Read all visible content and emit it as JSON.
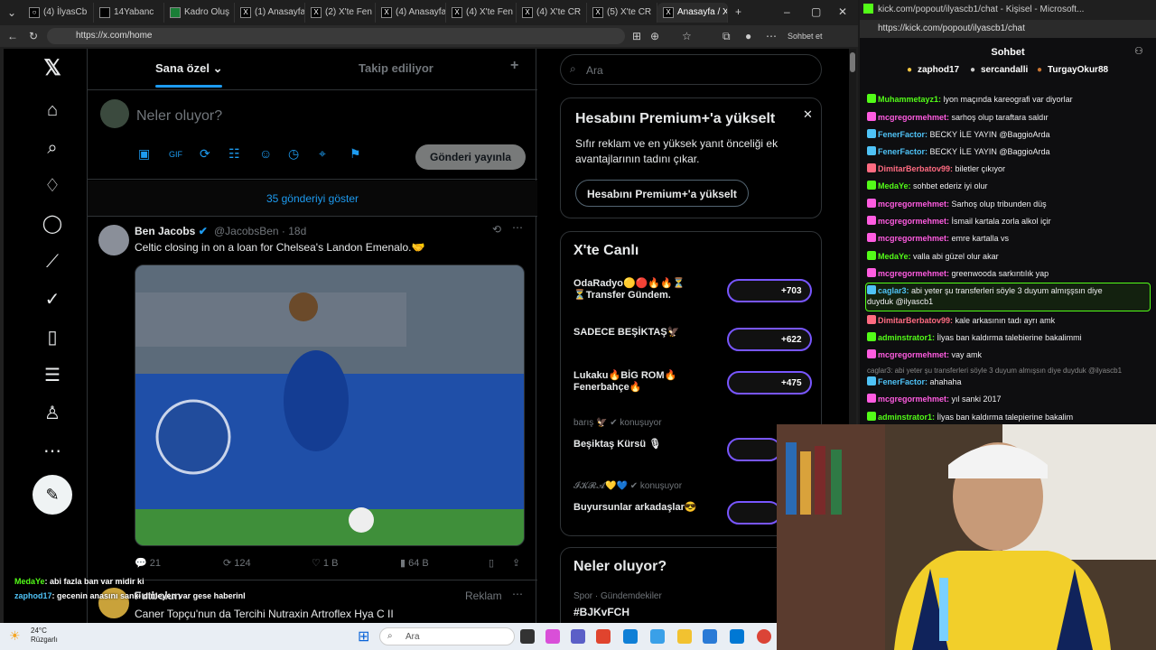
{
  "browser": {
    "tabs": [
      {
        "label": "(4) İlyasCb"
      },
      {
        "label": "14Yabanc"
      },
      {
        "label": "Kadro Oluş"
      },
      {
        "label": "(1) Anasayfa"
      },
      {
        "label": "(2) X'te Fen"
      },
      {
        "label": "(4) Anasayfa"
      },
      {
        "label": "(4) X'te Fen"
      },
      {
        "label": "(4) X'te CR"
      },
      {
        "label": "(5) X'te CR"
      },
      {
        "label": "Anasayfa / X"
      }
    ],
    "url": "https://x.com/home",
    "sidebar_btn": "Sohbet et"
  },
  "x": {
    "tabs": {
      "for_you": "Sana özel",
      "following": "Takip ediliyor"
    },
    "composer_placeholder": "Neler oluyor?",
    "post_button": "Gönderi yayınla",
    "show_more": "35 gönderiyi göster",
    "tweet": {
      "name": "Ben Jacobs",
      "handle": "@JacobsBen · 18d",
      "text": "Celtic closing in on a loan for Chelsea's Landon Emenalo.🤝",
      "replies": "21",
      "reposts": "124",
      "likes": "1 B",
      "views": "64 B"
    },
    "tweet2": {
      "name": "Futbolun",
      "text": "Caner Topçu'nun da Tercihi Nutraxin Artroflex Hya C II",
      "badge": "Reklam"
    },
    "search_placeholder": "Ara",
    "premium": {
      "title": "Hesabını Premium+'a yükselt",
      "body": "Sıfır reklam ve en yüksek yanıt önceliği ek avantajlarının tadını çıkar.",
      "button": "Hesabını Premium+'a yükselt"
    },
    "live": {
      "title": "X'te Canlı",
      "items": [
        {
          "title": "OdaRadyo🟡🔴🔥🔥⏳",
          "title2": "⏳Transfer Gündem.",
          "count": "+703"
        },
        {
          "title": "SADECE BEŞİKTAŞ🦅",
          "title2": "",
          "count": "+622"
        },
        {
          "title": "Lukaku🔥BİG ROM🔥",
          "title2": "Fenerbahçe🔥",
          "count": "+475"
        },
        {
          "sub": "barış 🦅 ✔ konuşuyor",
          "title": "Beşiktaş Kürsü 🎙",
          "count": ""
        },
        {
          "sub": "𝓘𝓚𝓡𝓐💛💙 ✔ konuşuyor",
          "title": "Buyursunlar arkadaşlar😎",
          "count": ""
        }
      ]
    },
    "trends": {
      "title": "Neler oluyor?",
      "sub": "Spor · Gündemdekiler",
      "tag": "#BJKvFCH"
    }
  },
  "chat": {
    "window_title": "kick.com/popout/ilyascb1/chat - Kişisel - Microsoft...",
    "url": "https://kick.com/popout/ilyascb1/chat",
    "header": "Sohbet",
    "top_gifters": [
      "zaphod17",
      "sercandalli",
      "TurgayOkur88"
    ],
    "messages": [
      {
        "user": "Muhammetayz1:",
        "text": "lyon maçında kareografi var diyorlar",
        "color": "#53fc18"
      },
      {
        "user": "mcgregormehmet:",
        "text": "sarhoş olup taraftara saldır",
        "color": "#ff5ce1"
      },
      {
        "user": "FenerFactor:",
        "text": "BECKY İLE YAYIN @BaggioArda",
        "color": "#4fc3f7"
      },
      {
        "user": "FenerFactor:",
        "text": "BECKY İLE YAYIN @BaggioArda",
        "color": "#4fc3f7"
      },
      {
        "user": "DimitarBerbatov99:",
        "text": "biletler çıkıyor",
        "color": "#ff6b81"
      },
      {
        "user": "MedaYe:",
        "text": "sohbet ederiz iyi olur",
        "color": "#53fc18"
      },
      {
        "user": "mcgregormehmet:",
        "text": "Sarhoş olup tribunden düş",
        "color": "#ff5ce1"
      },
      {
        "user": "mcgregormehmet:",
        "text": "İsmail kartala zorla alkol içir",
        "color": "#ff5ce1"
      },
      {
        "user": "mcgregormehmet:",
        "text": "emre kartalla vs",
        "color": "#ff5ce1"
      },
      {
        "user": "MedaYe:",
        "text": "valla abi güzel olur akar",
        "color": "#53fc18"
      },
      {
        "user": "mcgregormehmet:",
        "text": "greenwooda sarkıntılık yap",
        "color": "#ff5ce1"
      },
      {
        "user": "caglar3:",
        "text": "abi yeter şu transferleri söyle 3 duyum almışşsın diye",
        "text2": "duyduk @ilyascb1",
        "color": "#4fc3f7"
      },
      {
        "user": "DimitarBerbatov99:",
        "text": "kale arkasının tadı ayrı amk",
        "color": "#ff6b81"
      },
      {
        "user": "adminstrator1:",
        "text": "İlyas ban kaldırma talebierine bakalimmi",
        "color": "#53fc18"
      },
      {
        "user": "mcgregormehmet:",
        "text": "vay amk",
        "color": "#ff5ce1"
      },
      {
        "user": "",
        "text": "caglar3: abi yeter şu transferleri söyle 3 duyum almışsın diye duyduk @ilyascb1",
        "color": "#888"
      },
      {
        "user": "FenerFactor:",
        "text": "ahahaha",
        "color": "#4fc3f7"
      },
      {
        "user": "mcgregormehmet:",
        "text": "yıl sanki 2017",
        "color": "#ff5ce1"
      },
      {
        "user": "adminstrator1:",
        "text": "İlyas ban kaldırma talepierine bakalim",
        "color": "#53fc18"
      }
    ]
  },
  "overlay": {
    "line1_user": "MedaYe",
    "line1_text": ": abi fazla ban var midir ki",
    "line2_user": "zaphod17",
    "line2_text": ": gecenin anasını sanki dinleyen var gese haberinl"
  },
  "taskbar": {
    "temp": "24°C",
    "weather": "Rüzgarlı",
    "search": "Ara"
  }
}
